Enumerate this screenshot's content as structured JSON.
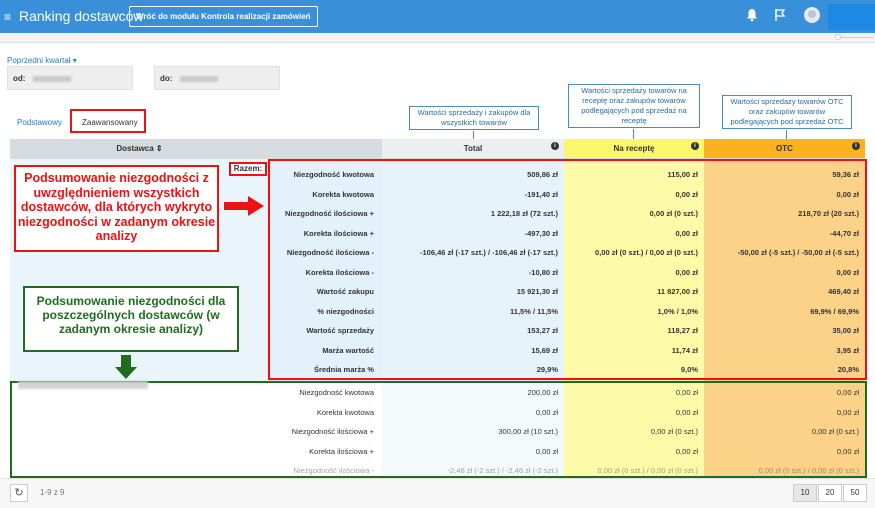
{
  "topbar": {
    "title": "Ranking dostawców",
    "back_button": "Wróć do modułu Kontrola realizacji zamówień"
  },
  "filters": {
    "period_link": "Poprzedni kwartał ▾",
    "from_label": "od:",
    "to_label": "do:"
  },
  "tabs": [
    "Podstawowy",
    "Zaawansowany"
  ],
  "callouts": {
    "total": "Wartości sprzedaży i zakupów dla wszystkich towarów",
    "recipe": "Wartości sprzedaży towarów na receptę oraz zakupów towarów podlegających pod sprzedaż na receptę",
    "otc": "Wartości sprzedaży towarów OTC oraz zakupów towarów podlegających pod sprzedaż OTC"
  },
  "columns": {
    "supplier": "Dostawca ⇕",
    "total": "Total",
    "recipe": "Na receptę",
    "otc": "OTC"
  },
  "razem_label": "Razem:",
  "summary_rows": [
    {
      "label": "Niezgodność kwotowa",
      "total": "509,86 zł",
      "recipe": "115,00 zł",
      "otc": "59,36 zł"
    },
    {
      "label": "Korekta kwotowa",
      "total": "-191,40 zł",
      "recipe": "0,00 zł",
      "otc": "0,00 zł"
    },
    {
      "label": "Niezgodność ilościowa +",
      "total": "1 222,18 zł (72 szt.)",
      "recipe": "0,00 zł (0 szt.)",
      "otc": "218,70 zł (20 szt.)"
    },
    {
      "label": "Korekta ilościowa +",
      "total": "-497,30 zł",
      "recipe": "0,00 zł",
      "otc": "-44,70 zł"
    },
    {
      "label": "Niezgodność ilościowa -",
      "total": "-106,46 zł (-17 szt.) / -106,46 zł (-17 szt.)",
      "recipe": "0,00 zł (0 szt.) / 0,00 zł (0 szt.)",
      "otc": "-50,00 zł (-5 szt.) / -50,00 zł (-5 szt.)"
    },
    {
      "label": "Korekta ilościowa -",
      "total": "-10,80 zł",
      "recipe": "0,00 zł",
      "otc": "0,00 zł"
    },
    {
      "label": "Wartość zakupu",
      "total": "15 921,30 zł",
      "recipe": "11 827,00 zł",
      "otc": "469,40 zł"
    },
    {
      "label": "% niezgodności",
      "total": "11,5% / 11,5%",
      "recipe": "1,0% / 1,0%",
      "otc": "69,9% / 69,9%"
    },
    {
      "label": "Wartość sprzedaży",
      "total": "153,27 zł",
      "recipe": "118,27 zł",
      "otc": "35,00 zł"
    },
    {
      "label": "Marża wartość",
      "total": "15,69 zł",
      "recipe": "11,74 zł",
      "otc": "3,95 zł"
    },
    {
      "label": "Średnia marża %",
      "total": "29,9%",
      "recipe": "9,0%",
      "otc": "20,8%"
    }
  ],
  "supplier_rows": [
    {
      "label": "Niezgodność kwotowa",
      "total": "200,00 zł",
      "recipe": "0,00 zł",
      "otc": "0,00 zł"
    },
    {
      "label": "Korekta kwotowa",
      "total": "0,00 zł",
      "recipe": "0,00 zł",
      "otc": "0,00 zł"
    },
    {
      "label": "Niezgodność ilościowa +",
      "total": "300,00 zł (10 szt.)",
      "recipe": "0,00 zł (0 szt.)",
      "otc": "0,00 zł (0 szt.)"
    },
    {
      "label": "Korekta ilościowa +",
      "total": "0,00 zł",
      "recipe": "0,00 zł",
      "otc": "0,00 zł"
    },
    {
      "label": "Niezgodność ilościowa -",
      "total": "-2,46 zł (-2 szt.) / -2,46 zł (-2 szt.)",
      "recipe": "0,00 zł (0 szt.) / 0,00 zł (0 szt.)",
      "otc": "0,00 zł (0 szt.) / 0,00 zł (0 szt.)"
    }
  ],
  "annotations": {
    "red_note": "Podsumowanie niezgodności z uwzględnieniem wszystkich dostawców, dla których wykryto niezgodności w zadanym okresie analizy",
    "green_note": "Podsumowanie niezgodności dla poszczególnych dostawców (w zadanym okresie analizy)"
  },
  "pager": {
    "info": "1-9 z 9",
    "sizes": [
      "10",
      "20",
      "50"
    ],
    "active_size": "10"
  },
  "colors": {
    "topbar": "#3a8fd9",
    "total_col": "#e6f3fb",
    "recipe_header": "#fbf76a",
    "recipe_col": "#fdfba8",
    "otc_header": "#fbb122",
    "otc_col": "#fcd289",
    "annotation_red": "#ee1111",
    "annotation_green": "#1f6b1f"
  }
}
